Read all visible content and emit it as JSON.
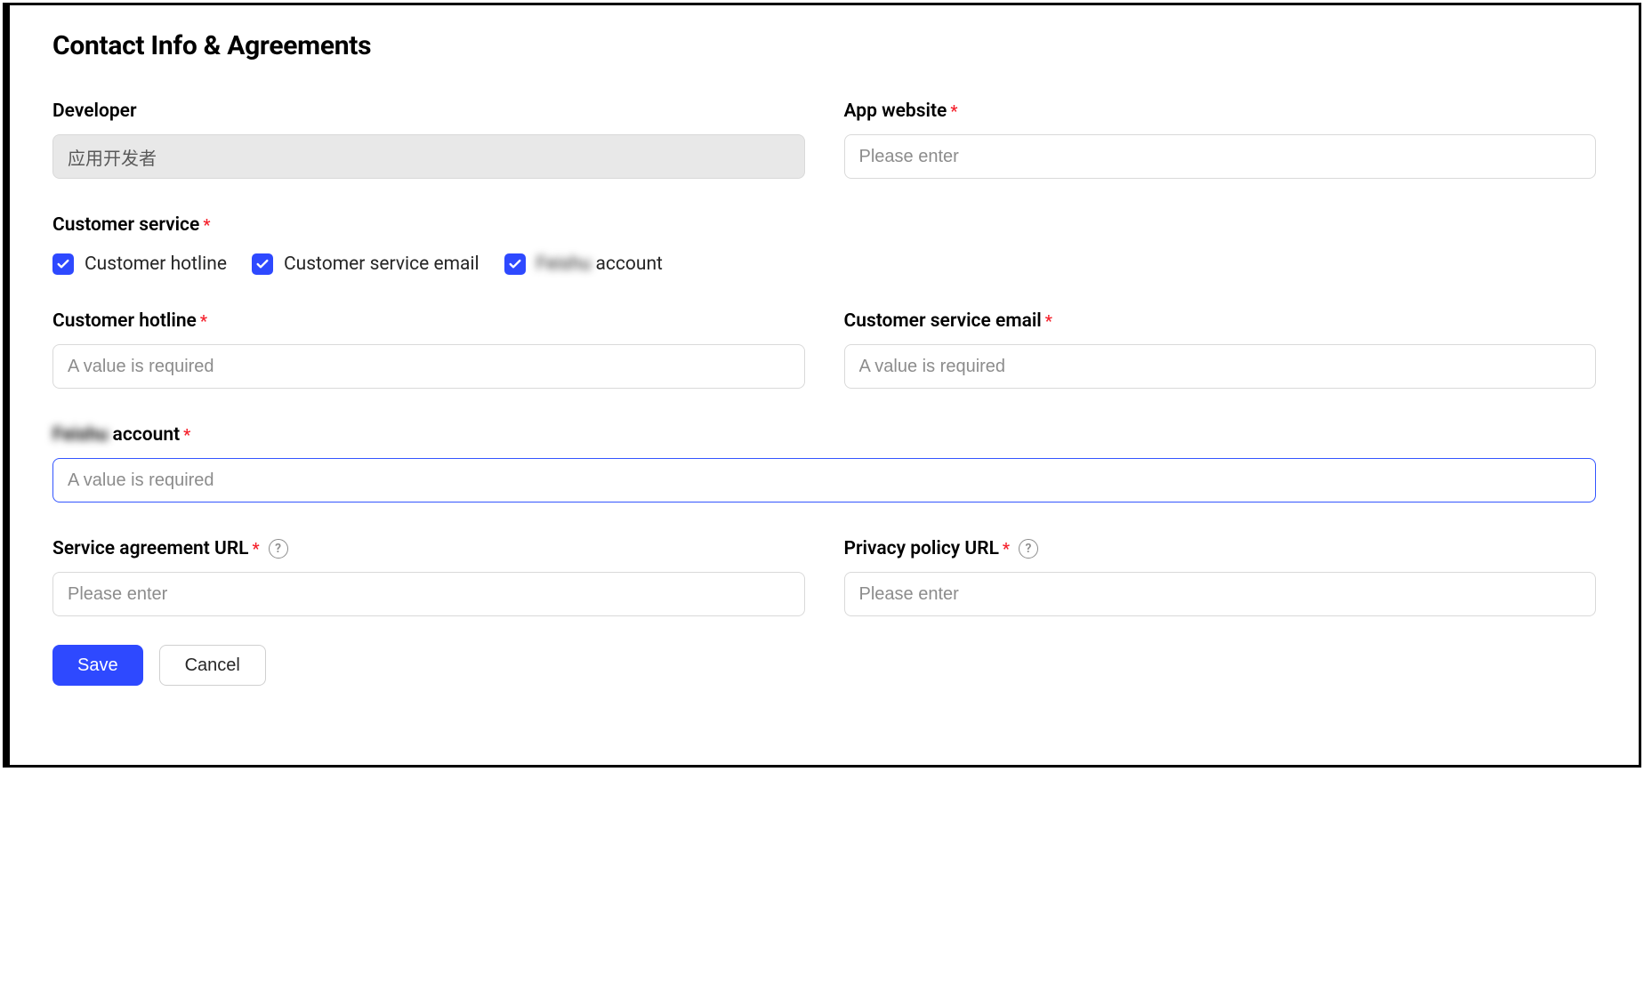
{
  "section": {
    "title": "Contact Info & Agreements"
  },
  "fields": {
    "developer": {
      "label": "Developer",
      "value": "应用开发者",
      "required": false
    },
    "app_website": {
      "label": "App website",
      "placeholder": "Please enter",
      "required": true
    },
    "customer_service": {
      "label": "Customer service",
      "required": true,
      "options": {
        "hotline": {
          "label": "Customer hotline",
          "checked": true
        },
        "email": {
          "label": "Customer service email",
          "checked": true
        },
        "account": {
          "label_prefix_redacted": "Feishu",
          "label_suffix": " account",
          "checked": true
        }
      }
    },
    "customer_hotline": {
      "label": "Customer hotline",
      "placeholder": "A value is required",
      "required": true
    },
    "customer_service_email": {
      "label": "Customer service email",
      "placeholder": "A value is required",
      "required": true
    },
    "account_field": {
      "label_prefix_redacted": "Feishu",
      "label_suffix": " account",
      "placeholder": "A value is required",
      "required": true
    },
    "service_agreement_url": {
      "label": "Service agreement URL",
      "placeholder": "Please enter",
      "required": true
    },
    "privacy_policy_url": {
      "label": "Privacy policy URL",
      "placeholder": "Please enter",
      "required": true
    }
  },
  "buttons": {
    "save": "Save",
    "cancel": "Cancel"
  },
  "glyphs": {
    "star": "*",
    "help": "?"
  }
}
